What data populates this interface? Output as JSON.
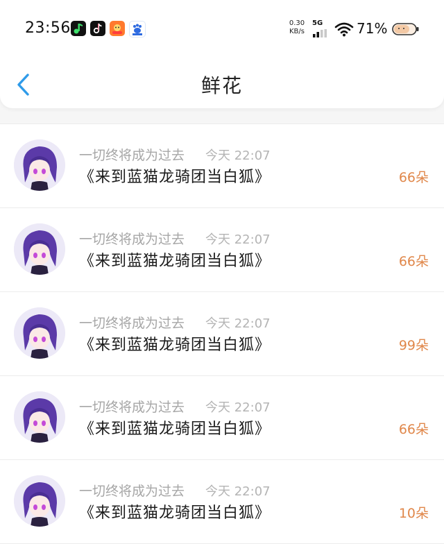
{
  "status_bar": {
    "time": "23:56",
    "speed_value": "0.30",
    "speed_unit": "KB/s",
    "network": "5G",
    "battery": "71%",
    "app_icons": [
      "music-app-icon",
      "tiktok-icon",
      "photo-app-icon",
      "baidu-icon"
    ]
  },
  "header": {
    "title": "鲜花"
  },
  "items": [
    {
      "name": "一切终将成为过去",
      "time": "今天 22:07",
      "book": "《来到蓝猫龙骑团当白狐》",
      "count": "66朵"
    },
    {
      "name": "一切终将成为过去",
      "time": "今天 22:07",
      "book": "《来到蓝猫龙骑团当白狐》",
      "count": "66朵"
    },
    {
      "name": "一切终将成为过去",
      "time": "今天 22:07",
      "book": "《来到蓝猫龙骑团当白狐》",
      "count": "99朵"
    },
    {
      "name": "一切终将成为过去",
      "time": "今天 22:07",
      "book": "《来到蓝猫龙骑团当白狐》",
      "count": "66朵"
    },
    {
      "name": "一切终将成为过去",
      "time": "今天 22:07",
      "book": "《来到蓝猫龙骑团当白狐》",
      "count": "10朵"
    }
  ],
  "colors": {
    "accent": "#2f9be9",
    "count": "#e0874a",
    "muted": "#a6a6a6"
  }
}
